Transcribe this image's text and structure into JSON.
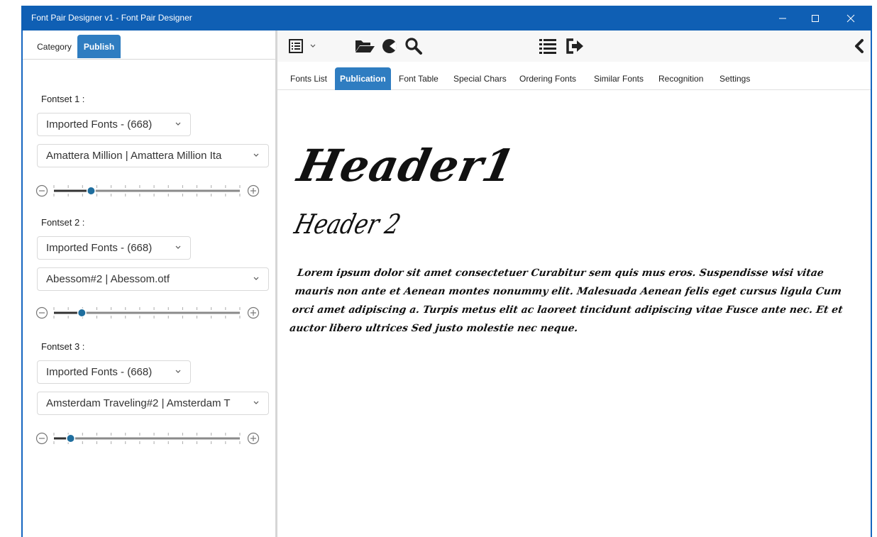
{
  "window": {
    "title": "Font Pair Designer v1 - Font Pair Designer",
    "accent_color": "#0f5fb4",
    "controls": [
      "minimize-icon",
      "maximize-icon",
      "close-icon"
    ]
  },
  "left_panel": {
    "tabs": [
      {
        "label": "Category",
        "active": false
      },
      {
        "label": "Publish",
        "active": true
      }
    ],
    "fontsets": [
      {
        "label": "Fontset 1 :",
        "category": "Imported Fonts - (668)",
        "font": "Amattera Million | Amattera Million Ita",
        "slider_fraction": 0.2
      },
      {
        "label": "Fontset 2 :",
        "category": "Imported Fonts - (668)",
        "font": "Abessom#2 | Abessom.otf",
        "slider_fraction": 0.15
      },
      {
        "label": "Fontset 3 :",
        "category": "Imported Fonts - (668)",
        "font": "Amsterdam Traveling#2 | Amsterdam T",
        "slider_fraction": 0.09
      }
    ]
  },
  "toolbar": {
    "icons": [
      "list-view-icon",
      "dropdown-chevron-icon",
      "folder-open-icon",
      "contrast-icon",
      "search-icon",
      "list-icon",
      "export-icon",
      "collapse-left-icon"
    ]
  },
  "tabs": [
    {
      "label": "Fonts List",
      "active": false
    },
    {
      "label": "Publication",
      "active": true
    },
    {
      "label": "Font Table",
      "active": false
    },
    {
      "label": "Special Chars",
      "active": false
    },
    {
      "label": "Ordering Fonts",
      "active": false
    },
    {
      "label": "Similar Fonts",
      "active": false
    },
    {
      "label": "Recognition",
      "active": false
    },
    {
      "label": "Settings",
      "active": false
    }
  ],
  "preview": {
    "header1": "Header1",
    "header2": "Header 2",
    "body": "Lorem ipsum dolor sit amet consectetuer Curabitur sem quis mus eros. Suspendisse wisi vitae mauris non ante et Aenean montes nonummy elit. Malesuada Aenean felis eget cursus ligula Cum orci amet adipiscing a. Turpis metus elit ac laoreet tincidunt adipiscing vitae Fusce ante nec. Et et auctor libero ultrices Sed justo molestie nec neque."
  }
}
